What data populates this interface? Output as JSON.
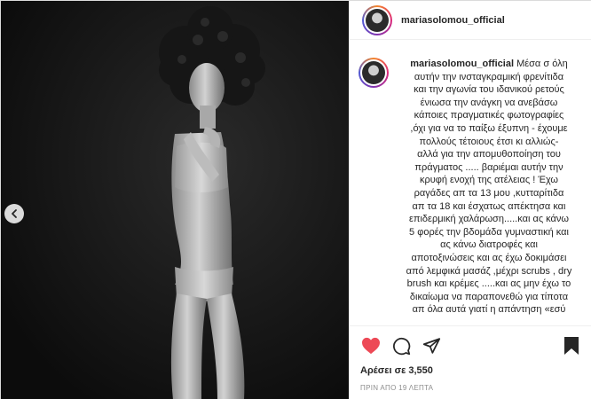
{
  "header": {
    "username": "mariasolomou_official"
  },
  "caption": {
    "username": "mariasolomou_official",
    "lines": [
      "Μέσα σ όλη",
      "αυτήν την ινσταγκραμική φρενίτιδα",
      "και την αγωνία του ιδανικού ρετούς",
      "ένιωσα την ανάγκη να ανεβάσω",
      "κάποιες πραγματικές φωτογραφίες",
      ",όχι για να το παίξω έξυπνη - έχουμε",
      "πολλούς τέτοιους έτσι κι αλλιώς-",
      "αλλά για την απομυθοποίηση του",
      "πράγματος ..... βαριέμαι αυτήν την",
      "κρυφή ενοχή της ατέλειας ! Έχω",
      "ραγάδες απ τα 13 μου ,κυτταρίτιδα",
      "απ τα 18 και έσχατως απέκτησα και",
      "επιδερμική χαλάρωση.....και ας κάνω",
      "5 φορές την βδομάδα γυμναστική και",
      "ας κάνω διατροφές και",
      "αποτοξινώσεις και ας έχω δοκιμάσει",
      "από λεμφικά μασάζ ,μέχρι scrubs , dry",
      "brush και κρέμες .....και ας μην έχω το",
      "δικαίωμα να παραπονεθώ για τίποτα",
      "απ όλα αυτά γιατί η απάντηση «εσύ"
    ]
  },
  "actions": {
    "icons": [
      "heart-icon",
      "comment-icon",
      "share-icon",
      "bookmark-icon"
    ],
    "liked": true,
    "like_color": "#ed4956",
    "likes_text": "Αρέσει σε 3,550",
    "timestamp": "ΠΡΙΝ ΑΠΟ 19 ΛΕΠΤΑ"
  },
  "photo": {
    "nav": "chevron-left-icon"
  }
}
